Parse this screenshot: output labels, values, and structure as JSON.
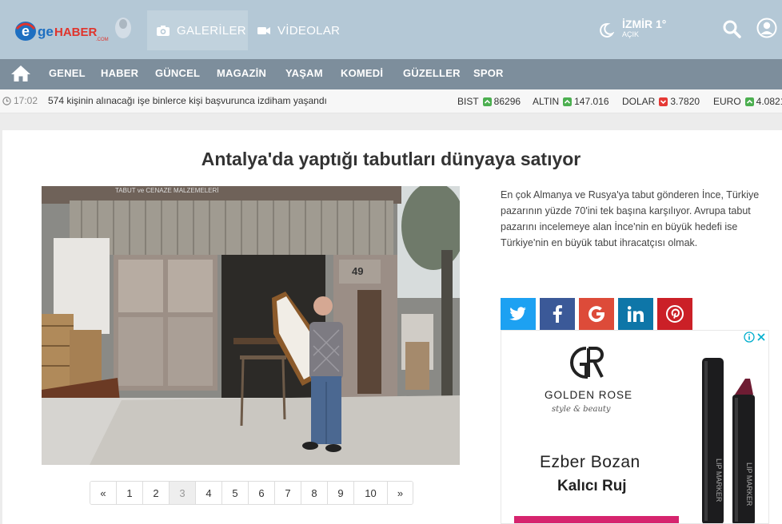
{
  "header": {
    "logo_alt": "egeHABER",
    "nav": [
      {
        "label": "GALERİLER",
        "icon": "camera-icon"
      },
      {
        "label": "VİDEOLAR",
        "icon": "video-icon"
      }
    ],
    "weather": {
      "city": "İZMİR",
      "temp": "1°",
      "condition": "AÇIK"
    },
    "brand_colors": {
      "bar": "#b4c8d6",
      "nav": "#7d8e9c",
      "logo_red": "#e0342c",
      "logo_blue": "#1e6fc1"
    }
  },
  "categories": [
    "GENEL",
    "HABER",
    "GÜNCEL",
    "MAGAZİN",
    "YAŞAM",
    "KOMEDİ",
    "GÜZELLER",
    "SPOR"
  ],
  "ticker": {
    "time": "17:02",
    "headline": "574 kişinin alınacağı işe binlerce kişi başvurunca izdiham yaşandı",
    "markets": [
      {
        "name": "BIST",
        "value": "86296",
        "trend": "up"
      },
      {
        "name": "ALTIN",
        "value": "147.016",
        "trend": "up"
      },
      {
        "name": "DOLAR",
        "value": "3.7820",
        "trend": "down"
      },
      {
        "name": "EURO",
        "value": "4.0821",
        "trend": "up"
      }
    ]
  },
  "article": {
    "title": "Antalya'da yaptığı tabutları dünyaya satıyor",
    "summary": "En çok Almanya ve Rusya'ya tabut gönderen İnce, Türkiye pazarının yüzde 70'ini tek başına karşılıyor. Avrupa tabut pazarını incelemeye alan İnce'nin en büyük hedefi ise Türkiye'nin en büyük tabut ihracatçısı olmak.",
    "photo_sign": "TABUT ve CENAZE MALZEMELERİ",
    "photo_door_number": "49"
  },
  "pagination": {
    "prev": "«",
    "next": "»",
    "pages": [
      "1",
      "2",
      "3",
      "4",
      "5",
      "6",
      "7",
      "8",
      "9",
      "10"
    ],
    "current": "3"
  },
  "share": [
    {
      "network": "twitter",
      "color": "#1da1f2"
    },
    {
      "network": "facebook",
      "color": "#3b5998"
    },
    {
      "network": "google",
      "color": "#dd4b39"
    },
    {
      "network": "linkedin",
      "color": "#0e76a8"
    },
    {
      "network": "pinterest",
      "color": "#cb2027"
    }
  ],
  "ad": {
    "brand": "GOLDEN ROSE",
    "tagline": "style & beauty",
    "headline": "Ezber Bozan",
    "subheadline": "Kalıcı Ruj",
    "product_label": "LIP MARKER"
  }
}
